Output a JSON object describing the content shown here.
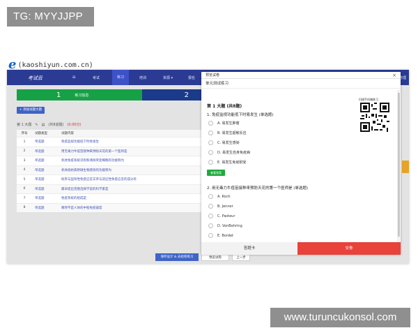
{
  "tag": "TG: MYYJJPP",
  "site": {
    "logo": "e",
    "url": "(kaoshiyun.com.cn)"
  },
  "app": {
    "brand": "考试云",
    "nav": {
      "home_icon": "home-icon",
      "items": [
        "考试",
        "练习",
        "培训",
        "资源 ▾",
        "报名"
      ]
    },
    "corner_text": "管理"
  },
  "steps": {
    "step1_num": "1",
    "step1_label": "练习信息",
    "step2_num": "2"
  },
  "new_button": "+ 添加试题大题",
  "meta": {
    "section": "第 1 大题",
    "count": "(共8道题)",
    "score": "(0.00分)"
  },
  "table": {
    "headers": [
      "序号",
      "试题类型",
      "试题内容"
    ],
    "rows": [
      {
        "no": "1",
        "type": "单选题",
        "content": "免疫监视功能低下时易发生"
      },
      {
        "no": "2",
        "type": "单选题",
        "content": "用无毒力牛痘苗接种来预防天花的第一个医师是"
      },
      {
        "no": "3",
        "type": "单选题",
        "content": "机体免疫系统识别和清除突变细胞的功能称为"
      },
      {
        "no": "4",
        "type": "单选题",
        "content": "机体抵抗病原微生物感染的功能称为"
      },
      {
        "no": "5",
        "type": "单选题",
        "content": "既参与固有性免疫应答又参与适应性免疫应答的成分有"
      },
      {
        "no": "6",
        "type": "单选题",
        "content": "最早提出克隆选择学说的科学家是"
      },
      {
        "no": "7",
        "type": "单选题",
        "content": "免疫系统的组成是"
      },
      {
        "no": "8",
        "type": "单选题",
        "content": "哪项不是人体的中枢免疫器官"
      }
    ]
  },
  "bottom_buttons": {
    "save": "保存设计 & 去组卷练习",
    "preview": "预览试卷",
    "prev": "上一步"
  },
  "modal": {
    "title": "预览试卷",
    "close": "×",
    "subtitle": "单元测试练习",
    "section_title": "第 1 大题 (共8题)",
    "qr_label": "扫描手机端练习",
    "q1": {
      "text": "1. 免疫监视功能低下时易发生  (单选题)",
      "options": [
        "A. 易发生肿瘤",
        "B. 易发生超敏反应",
        "C. 易发生感染",
        "D. 易发生自身免疫病",
        "E. 易发生免疫耐受"
      ]
    },
    "answer_button": "查看答案",
    "q2": {
      "text": "2. 用无毒力牛痘苗接种来预防天花的第一个医师是  (单选题)",
      "options": [
        "A. Koch",
        "B. Jenner",
        "C. Pasteur",
        "D. VonBehring",
        "E. Bordet"
      ]
    },
    "footer": {
      "answer_card": "答题卡",
      "submit": "交卷"
    }
  },
  "watermark": "www.turuncukonsol.com",
  "colors": {
    "nav": "#2b3b94",
    "step_active": "#17a146",
    "step_next": "#1c3a8a",
    "submit": "#e8423b",
    "answer_btn": "#1faa3c"
  }
}
